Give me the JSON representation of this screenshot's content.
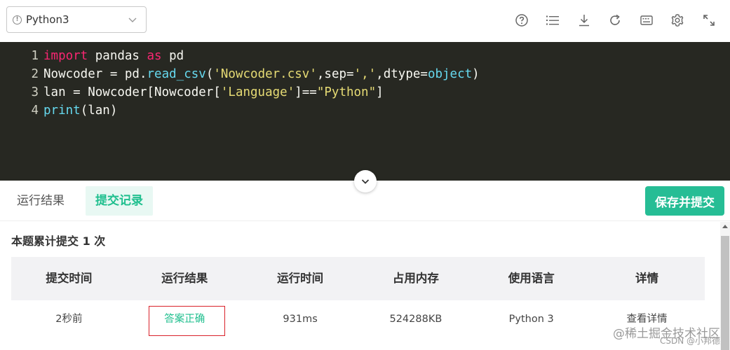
{
  "toolbar": {
    "language": "Python3",
    "icons": [
      "help-icon",
      "list-icon",
      "download-icon",
      "refresh-icon",
      "keyboard-icon",
      "gear-icon",
      "fullscreen-icon"
    ]
  },
  "editor": {
    "lines": [
      {
        "num": "1",
        "tokens": [
          {
            "t": "import",
            "c": "kw"
          },
          {
            "t": " pandas ",
            "c": "tx"
          },
          {
            "t": "as",
            "c": "kw"
          },
          {
            "t": " pd",
            "c": "tx"
          }
        ]
      },
      {
        "num": "2",
        "tokens": [
          {
            "t": "Nowcoder = pd.",
            "c": "tx"
          },
          {
            "t": "read_csv",
            "c": "fn"
          },
          {
            "t": "(",
            "c": "tx"
          },
          {
            "t": "'Nowcoder.csv'",
            "c": "st"
          },
          {
            "t": ",sep=",
            "c": "tx"
          },
          {
            "t": "','",
            "c": "st"
          },
          {
            "t": ",dtype=",
            "c": "tx"
          },
          {
            "t": "object",
            "c": "fn"
          },
          {
            "t": ")",
            "c": "tx"
          }
        ]
      },
      {
        "num": "3",
        "tokens": [
          {
            "t": "lan = Nowcoder[Nowcoder[",
            "c": "tx"
          },
          {
            "t": "'Language'",
            "c": "st"
          },
          {
            "t": "]==",
            "c": "tx"
          },
          {
            "t": "\"Python\"",
            "c": "st"
          },
          {
            "t": "]",
            "c": "tx"
          }
        ]
      },
      {
        "num": "4",
        "tokens": [
          {
            "t": "print",
            "c": "fn"
          },
          {
            "t": "(lan)",
            "c": "tx"
          }
        ]
      }
    ]
  },
  "tabs": {
    "result": "运行结果",
    "submissions": "提交记录",
    "save_submit": "保存并提交"
  },
  "panel": {
    "summary": "本题累计提交 1 次",
    "headers": [
      "提交时间",
      "运行结果",
      "运行时间",
      "占用内存",
      "使用语言",
      "详情"
    ],
    "row": {
      "time": "2秒前",
      "result": "答案正确",
      "runtime": "931ms",
      "memory": "524288KB",
      "language": "Python 3",
      "details": "查看详情"
    }
  },
  "watermark": {
    "main": "@稀土掘金技术社区",
    "sub": "CSDN @小邦德"
  },
  "colors": {
    "accent": "#26bd95",
    "editor_bg": "#272822",
    "highlight_box": "#d9222a"
  }
}
